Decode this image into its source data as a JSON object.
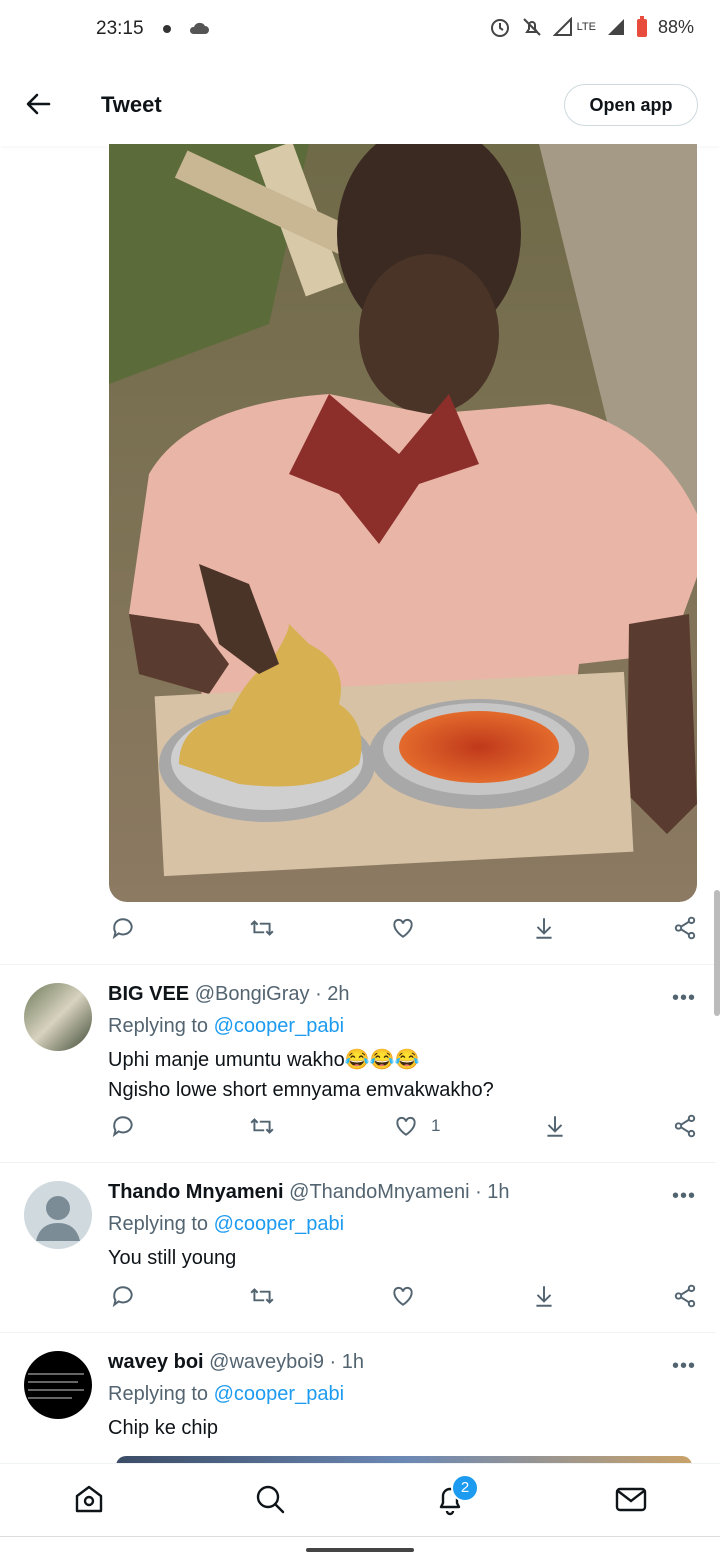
{
  "status_bar": {
    "time": "23:15",
    "battery": "88%",
    "network": "LTE"
  },
  "header": {
    "title": "Tweet",
    "open_app_label": "Open app"
  },
  "tweet": {
    "photo_alt": ""
  },
  "replies": [
    {
      "name": "BIG VEE",
      "handle": "@BongiGray",
      "time": "· 2h",
      "replying_label": "Replying to",
      "replying_to": "@cooper_pabi",
      "line1": "Uphi manje umuntu wakho😂😂😂",
      "line2": "Ngisho lowe short emnyama emvakwakho?",
      "like_count": "1"
    },
    {
      "name": "Thando Mnyameni",
      "handle": "@ThandoMnyameni",
      "time": "· 1h",
      "replying_label": "Replying to",
      "replying_to": "@cooper_pabi",
      "line1": "You still young",
      "like_count": ""
    },
    {
      "name": "wavey boi",
      "handle": "@waveyboi9",
      "time": "· 1h",
      "replying_label": "Replying to",
      "replying_to": "@cooper_pabi",
      "line1": "Chip ke chip"
    }
  ],
  "more_label": "•••",
  "nav": {
    "notifications_badge": "2"
  },
  "colors": {
    "accent": "#1d9bf0",
    "text": "#0f1419",
    "muted": "#536471"
  }
}
